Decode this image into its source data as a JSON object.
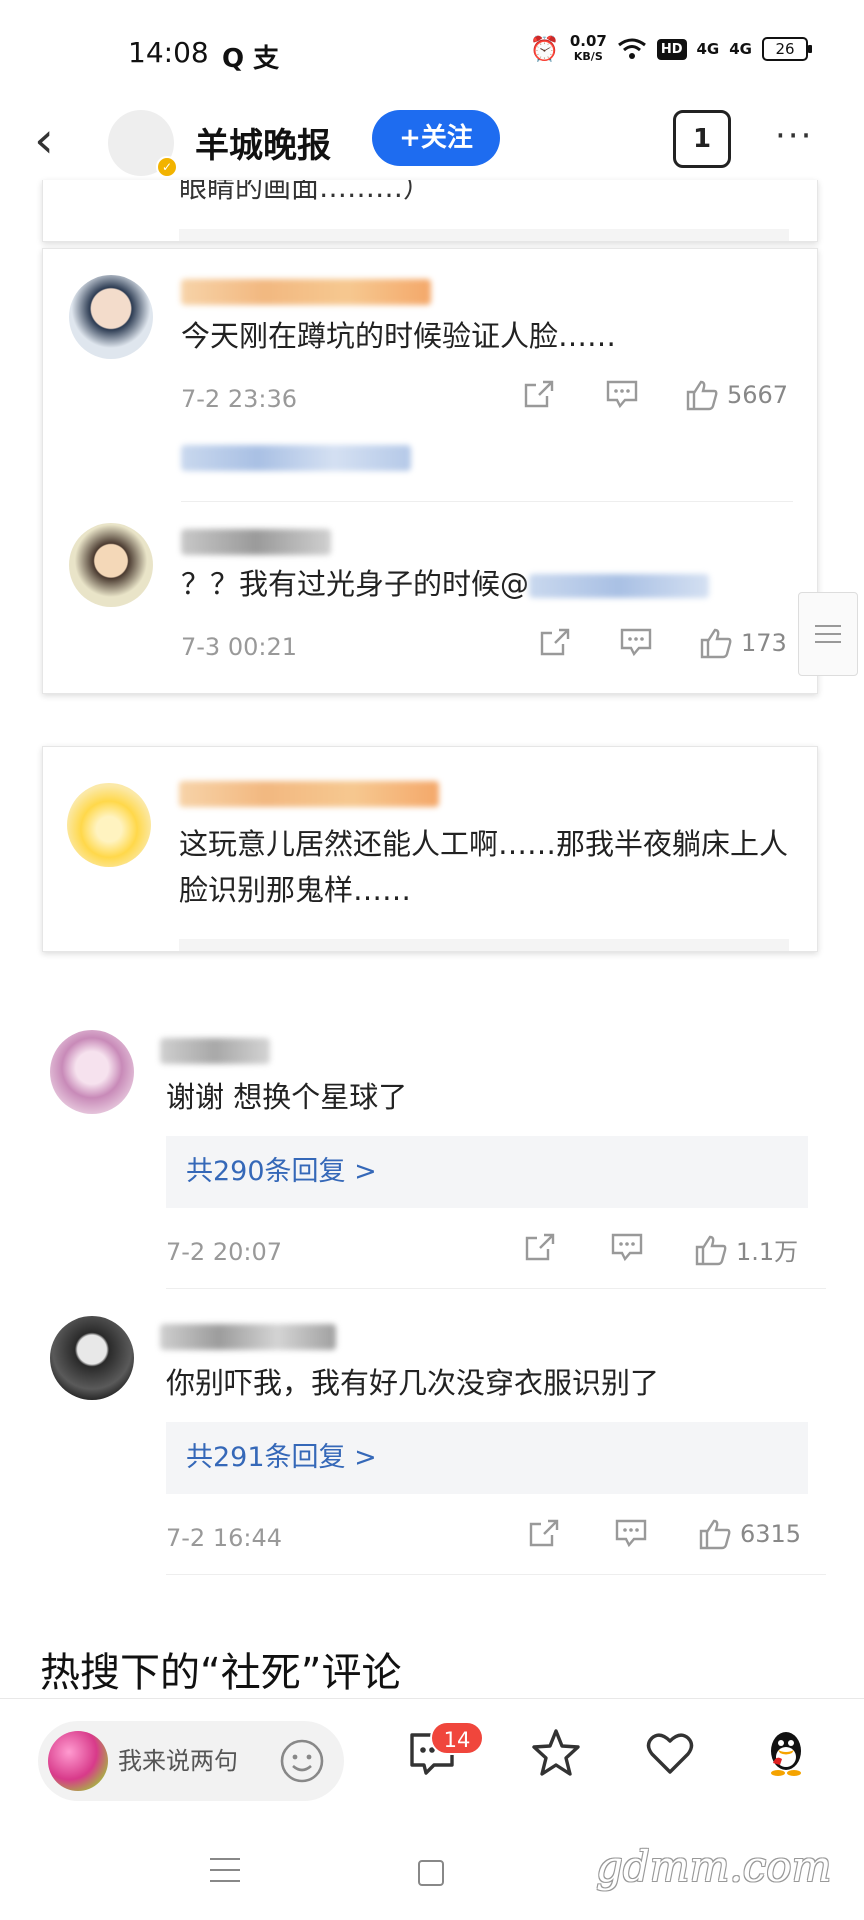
{
  "status_bar": {
    "time": "14:08",
    "left_icons": "Q 支",
    "net_speed_value": "0.07",
    "net_speed_unit": "KB/S",
    "hd": "HD",
    "signal_1": "4G",
    "signal_2": "4G",
    "battery": "26"
  },
  "header": {
    "back_icon": "‹",
    "account_name": "羊城晚报",
    "follow_label": "+关注",
    "tab_count": "1",
    "more_icon": "···"
  },
  "partial_card": {
    "text": "眼睛的画面………）"
  },
  "quoted_card_1": {
    "comments": [
      {
        "text": "今天刚在蹲坑的时候验证人脸……",
        "time": "7-2 23:36",
        "likes": "5667"
      },
      {
        "text_prefix": "？？我有过光身子的时候@",
        "time": "7-3 00:21",
        "likes": "173"
      }
    ]
  },
  "quoted_card_2": {
    "text": "这玩意儿居然还能人工啊……那我半夜躺床上人脸识别那鬼样……"
  },
  "comments": [
    {
      "text": "谢谢 想换个星球了",
      "replies_label": "共290条回复 >",
      "time": "7-2 20:07",
      "likes": "1.1万"
    },
    {
      "text": "你别吓我，我有好几次没穿衣服识别了",
      "replies_label": "共291条回复 >",
      "time": "7-2 16:44",
      "likes": "6315"
    }
  ],
  "section_title": "热搜下的“社死”评论",
  "bottom_bar": {
    "input_placeholder": "我来说两句",
    "comment_badge": "14"
  },
  "watermark": "gdmm.com",
  "colors": {
    "accent": "#1e6cf0",
    "reply_link": "#3568b8",
    "badge": "#f0463c",
    "verify": "#f2b300"
  }
}
